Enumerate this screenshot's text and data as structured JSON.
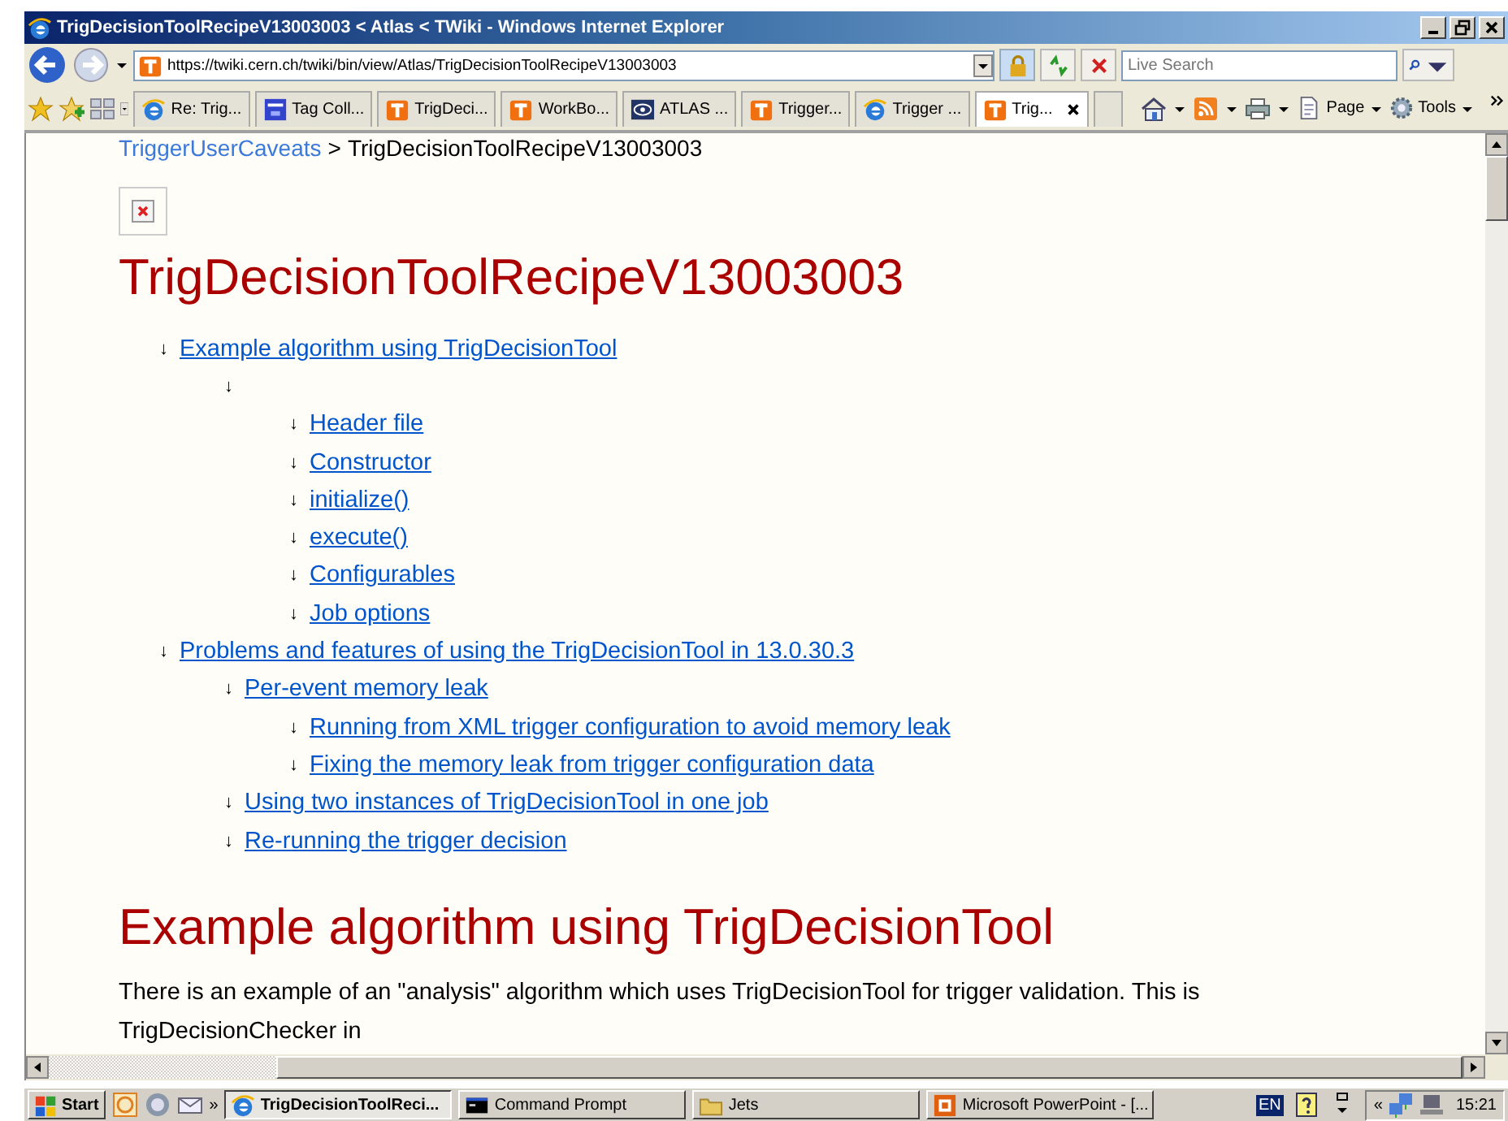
{
  "window": {
    "title": "TrigDecisionToolRecipeV13003003 < Atlas < TWiki - Windows Internet Explorer"
  },
  "address_bar": {
    "url": "https://twiki.cern.ch/twiki/bin/view/Atlas/TrigDecisionToolRecipeV13003003"
  },
  "search": {
    "placeholder": "Live Search"
  },
  "tabs": [
    {
      "label": "Re: Trig...",
      "kind": "ie",
      "selected": false
    },
    {
      "label": "Tag Coll...",
      "kind": "tc",
      "selected": false
    },
    {
      "label": "TrigDeci...",
      "kind": "t",
      "selected": false
    },
    {
      "label": "WorkBo...",
      "kind": "t",
      "selected": false
    },
    {
      "label": "ATLAS ...",
      "kind": "atlas",
      "selected": false
    },
    {
      "label": "Trigger...",
      "kind": "t",
      "selected": false
    },
    {
      "label": "Trigger ...",
      "kind": "ie",
      "selected": false
    },
    {
      "label": "Trig...",
      "kind": "t",
      "selected": true
    }
  ],
  "command_bar": [
    {
      "label": "Page"
    },
    {
      "label": "Tools"
    }
  ],
  "breadcrumb": {
    "link": "TriggerUserCaveats",
    "separator": ">",
    "current": "TrigDecisionToolRecipeV13003003"
  },
  "page_title": "TrigDecisionToolRecipeV13003003",
  "toc_marker": "↓",
  "toc": [
    {
      "label": "Example algorithm using TrigDecisionTool",
      "children": [
        {
          "children": [
            {
              "label": "Header file"
            },
            {
              "label": "Constructor"
            },
            {
              "label": "initialize()"
            },
            {
              "label": "execute()"
            },
            {
              "label": "Configurables"
            },
            {
              "label": "Job options"
            }
          ]
        }
      ]
    },
    {
      "label": "Problems and features of using the TrigDecisionTool in 13.0.30.3",
      "children": [
        {
          "label": "Per-event memory leak",
          "children": [
            {
              "label": "Running from XML trigger configuration to avoid memory leak"
            },
            {
              "label": "Fixing the memory leak from trigger configuration data"
            }
          ]
        },
        {
          "label": "Using two instances of TrigDecisionTool in one job"
        },
        {
          "label": "Re-running the trigger decision"
        }
      ]
    }
  ],
  "section_heading": "Example algorithm using TrigDecisionTool",
  "paragraph": "There is an example of an \"analysis\" algorithm which uses TrigDecisionTool for trigger validation. This is TrigDecisionChecker in",
  "taskbar": {
    "start": "Start",
    "more": "»",
    "tasks": [
      {
        "label": "TrigDecisionToolReci...",
        "kind": "ie",
        "selected": true
      },
      {
        "label": "Command Prompt",
        "kind": "cmd",
        "selected": false
      },
      {
        "label": "Jets",
        "kind": "folder",
        "selected": false
      },
      {
        "label": "Microsoft PowerPoint - [...",
        "kind": "ppt",
        "selected": false
      }
    ],
    "language": "EN",
    "tray_more": "«",
    "clock": "15:21"
  }
}
